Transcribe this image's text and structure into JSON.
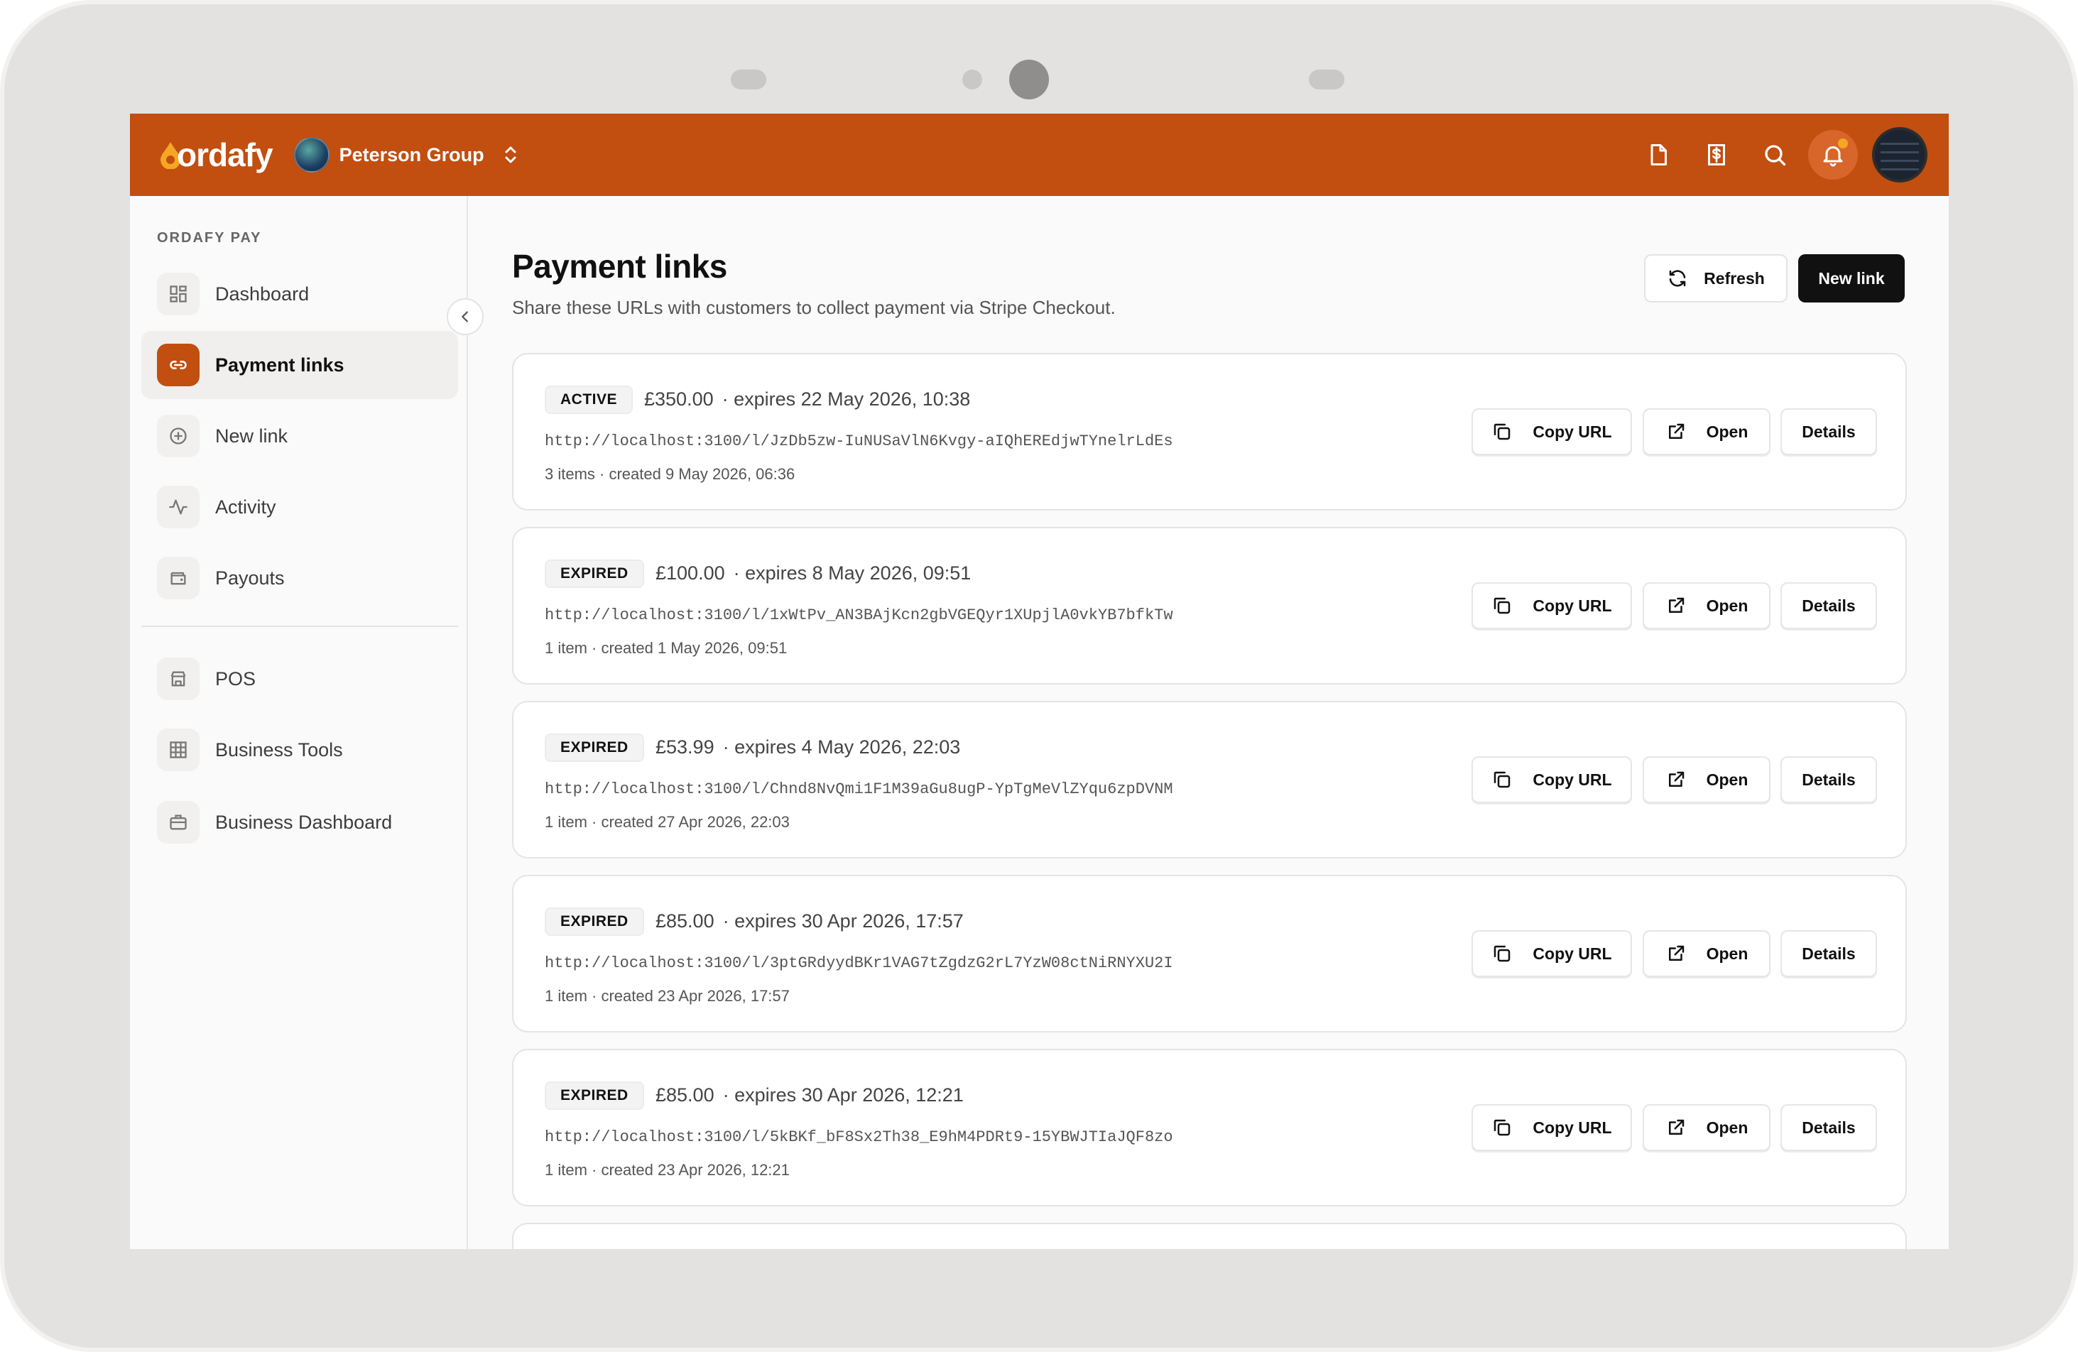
{
  "header": {
    "logo_text": "ordafy",
    "org_name": "Peterson Group"
  },
  "sidebar": {
    "heading": "ORDAFY PAY",
    "items": [
      {
        "label": "Dashboard",
        "icon": "grid-icon"
      },
      {
        "label": "Payment links",
        "icon": "link-icon",
        "active": true
      },
      {
        "label": "New link",
        "icon": "plus-circle-icon"
      },
      {
        "label": "Activity",
        "icon": "activity-icon"
      },
      {
        "label": "Payouts",
        "icon": "wallet-icon"
      },
      {
        "label": "POS",
        "icon": "store-icon"
      },
      {
        "label": "Business Tools",
        "icon": "table-icon"
      },
      {
        "label": "Business Dashboard",
        "icon": "briefcase-icon"
      }
    ]
  },
  "main": {
    "title": "Payment links",
    "subtitle": "Share these URLs with customers to collect payment via Stripe Checkout.",
    "refresh_label": "Refresh",
    "new_link_label": "New link",
    "copy_label": "Copy URL",
    "open_label": "Open",
    "details_label": "Details",
    "links": [
      {
        "status": "ACTIVE",
        "amount": "£350.00",
        "expires": "· expires 22 May 2026, 10:38",
        "url": "http://localhost:3100/l/JzDb5zw-IuNUSaVlN6Kvgy-aIQhEREdjwTYnelrLdEs",
        "meta": "3 items · created 9 May 2026, 06:36"
      },
      {
        "status": "EXPIRED",
        "amount": "£100.00",
        "expires": "· expires 8 May 2026, 09:51",
        "url": "http://localhost:3100/l/1xWtPv_AN3BAjKcn2gbVGEQyr1XUpjlA0vkYB7bfkTw",
        "meta": "1 item · created 1 May 2026, 09:51"
      },
      {
        "status": "EXPIRED",
        "amount": "£53.99",
        "expires": "· expires 4 May 2026, 22:03",
        "url": "http://localhost:3100/l/Chnd8NvQmi1F1M39aGu8ugP-YpTgMeVlZYqu6zpDVNM",
        "meta": "1 item · created 27 Apr 2026, 22:03"
      },
      {
        "status": "EXPIRED",
        "amount": "£85.00",
        "expires": "· expires 30 Apr 2026, 17:57",
        "url": "http://localhost:3100/l/3ptGRdyydBKr1VAG7tZgdzG2rL7YzW08ctNiRNYXU2I",
        "meta": "1 item · created 23 Apr 2026, 17:57"
      },
      {
        "status": "EXPIRED",
        "amount": "£85.00",
        "expires": "· expires 30 Apr 2026, 12:21",
        "url": "http://localhost:3100/l/5kBKf_bF8Sx2Th38_E9hM4PDRt9-15YBWJTIaJQF8zo",
        "meta": "1 item · created 23 Apr 2026, 12:21"
      }
    ]
  },
  "colors": {
    "brand": "#c24e10",
    "primary_button": "#111111"
  }
}
